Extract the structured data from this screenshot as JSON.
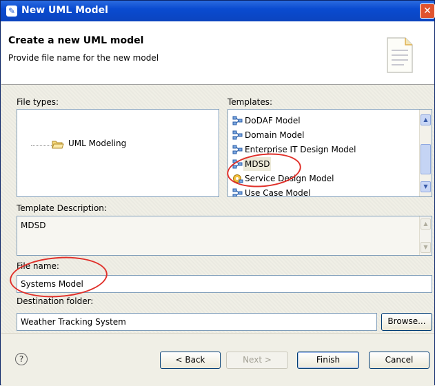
{
  "window": {
    "title": "New UML Model",
    "close": "✕"
  },
  "banner": {
    "title": "Create a new UML model",
    "subtitle": "Provide file name for the new model"
  },
  "file_types": {
    "label": "File types:",
    "items": [
      {
        "label": "UML Modeling"
      }
    ]
  },
  "templates": {
    "label": "Templates:",
    "items": [
      {
        "label": "DoDAF Model",
        "icon": "model-icon"
      },
      {
        "label": "Domain Model",
        "icon": "model-icon"
      },
      {
        "label": "Enterprise IT Design Model",
        "icon": "model-icon"
      },
      {
        "label": "MDSD",
        "icon": "model-icon",
        "selected": true
      },
      {
        "label": "Service Design Model",
        "icon": "service-model-icon"
      },
      {
        "label": "Use Case Model",
        "icon": "model-icon"
      }
    ]
  },
  "description": {
    "label": "Template Description:",
    "value": "MDSD"
  },
  "file_name": {
    "label": "File name:",
    "value": "Systems Model"
  },
  "destination": {
    "label": "Destination folder:",
    "value": "Weather Tracking System",
    "browse": "Browse..."
  },
  "footer": {
    "help": "?",
    "back": "< Back",
    "next": "Next >",
    "finish": "Finish",
    "cancel": "Cancel"
  },
  "colors": {
    "annotation": "#e0302a",
    "title_bar": "#0a4bd0"
  }
}
